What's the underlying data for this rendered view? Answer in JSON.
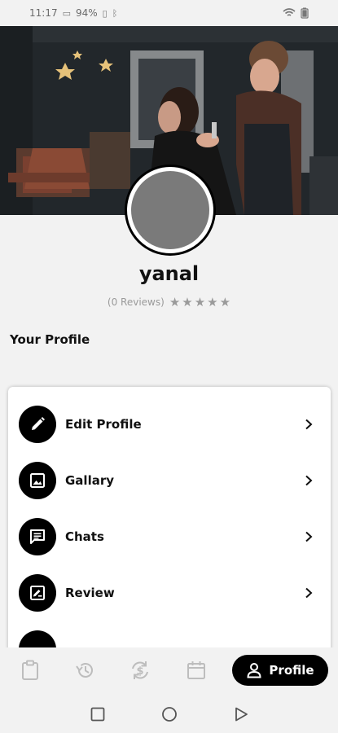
{
  "status_bar": {
    "time": "11:17",
    "battery": "94%"
  },
  "profile": {
    "username": "yanal",
    "reviews_text": "(0 Reviews)",
    "rating": 0,
    "max_rating": 5
  },
  "section": {
    "title": "Your Profile"
  },
  "menu": {
    "items": [
      {
        "label": "Edit Profile",
        "icon": "pencil-icon"
      },
      {
        "label": "Gallary",
        "icon": "image-icon"
      },
      {
        "label": "Chats",
        "icon": "chat-icon"
      },
      {
        "label": "Review",
        "icon": "review-icon"
      }
    ]
  },
  "bottom_nav": {
    "items": [
      {
        "icon": "clipboard-icon"
      },
      {
        "icon": "history-icon"
      },
      {
        "icon": "sync-dollar-icon"
      },
      {
        "icon": "calendar-icon"
      }
    ],
    "active_label": "Profile",
    "active_icon": "person-icon"
  },
  "colors": {
    "accent": "#000000",
    "background": "#f2f2f2",
    "muted_text": "#9a9a9a",
    "avatar_fill": "#7a7a7a"
  }
}
